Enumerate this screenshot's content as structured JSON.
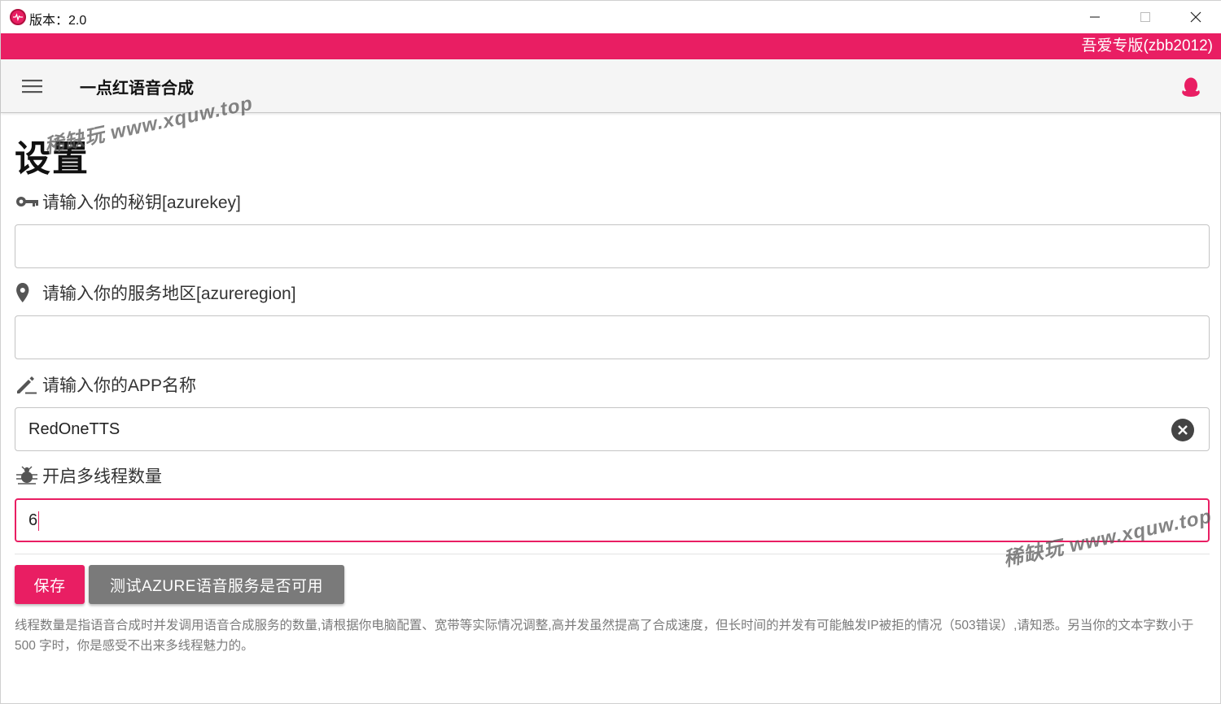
{
  "window": {
    "title": "版本：2.0",
    "banner": "吾爱专版(zbb2012)"
  },
  "appbar": {
    "title": "一点红语音合成",
    "menu_icon": "menu-icon",
    "right_icon": "qq-penguin-icon"
  },
  "page": {
    "title": "设置"
  },
  "fields": [
    {
      "label": "请输入你的秘钥[azurekey]",
      "icon": "key-icon",
      "value": "",
      "placeholder": ""
    },
    {
      "label": "请输入你的服务地区[azureregion]",
      "icon": "location-pin-icon",
      "value": "",
      "placeholder": ""
    },
    {
      "label": "请输入你的APP名称",
      "icon": "pencil-icon",
      "value": "RedOneTTS",
      "placeholder": ""
    },
    {
      "label": "开启多线程数量",
      "icon": "bug-icon",
      "value": "6",
      "placeholder": ""
    }
  ],
  "buttons": {
    "save": "保存",
    "test": "测试AZURE语音服务是否可用"
  },
  "note": "线程数量是指语音合成时并发调用语音合成服务的数量,请根据你电脑配置、宽带等实际情况调整,高并发虽然提高了合成速度，但长时间的并发有可能触发IP被拒的情况（503错误）,请知悉。另当你的文本字数小于500 字时，你是感受不出来多线程魅力的。",
  "watermarks": [
    "稀缺玩 www.xquw.top",
    "稀缺玩 www.xquw.top"
  ],
  "colors": {
    "accent": "#e91e63",
    "test_button": "#7a7a7a",
    "appbar_bg": "#f5f5f5"
  }
}
